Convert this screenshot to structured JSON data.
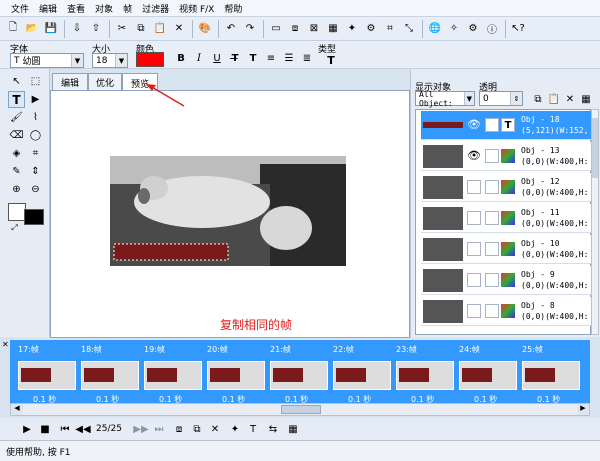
{
  "menu": [
    "文件",
    "编辑",
    "查看",
    "对象",
    "帧",
    "过滤器",
    "视频 F/X",
    "帮助"
  ],
  "toolbar2": {
    "font_label": "字体",
    "font_value": "幼圆",
    "size_label": "大小",
    "size_value": "18",
    "color_label": "颜色",
    "color_value": "#ff0000",
    "type_label": "类型"
  },
  "tabs": [
    "编辑",
    "优化",
    "预览"
  ],
  "active_tab": "预览",
  "canvas_note": "复制相同的帧",
  "right_panel": {
    "display_label": "显示对象",
    "display_value": "All Object:",
    "opacity_label": "透明",
    "opacity_value": "0",
    "objects": [
      {
        "line1": "Obj - 18",
        "line2": "(5,121)(W:152,"
      },
      {
        "line1": "Obj - 13",
        "line2": "(0,0)(W:400,H:"
      },
      {
        "line1": "Obj - 12",
        "line2": "(0,0)(W:400,H:"
      },
      {
        "line1": "Obj - 11",
        "line2": "(0,0)(W:400,H:"
      },
      {
        "line1": "Obj - 10",
        "line2": "(0,0)(W:400,H:"
      },
      {
        "line1": "Obj - 9",
        "line2": "(0,0)(W:400,H:"
      },
      {
        "line1": "Obj - 8",
        "line2": "(0,0)(W:400,H:"
      }
    ]
  },
  "frames": [
    {
      "label": "17:帧",
      "delay": "0.1 秒"
    },
    {
      "label": "18:帧",
      "delay": "0.1 秒"
    },
    {
      "label": "19:帧",
      "delay": "0.1 秒"
    },
    {
      "label": "20:帧",
      "delay": "0.1 秒"
    },
    {
      "label": "21:帧",
      "delay": "0.1 秒"
    },
    {
      "label": "22:帧",
      "delay": "0.1 秒"
    },
    {
      "label": "23:帧",
      "delay": "0.1 秒"
    },
    {
      "label": "24:帧",
      "delay": "0.1 秒"
    },
    {
      "label": "25:帧",
      "delay": "0.1 秒"
    }
  ],
  "frame_counter": "25/25",
  "status": "使用帮助, 按 F1",
  "colors": {
    "accent": "#3399ff",
    "highlight": "#e02020"
  }
}
